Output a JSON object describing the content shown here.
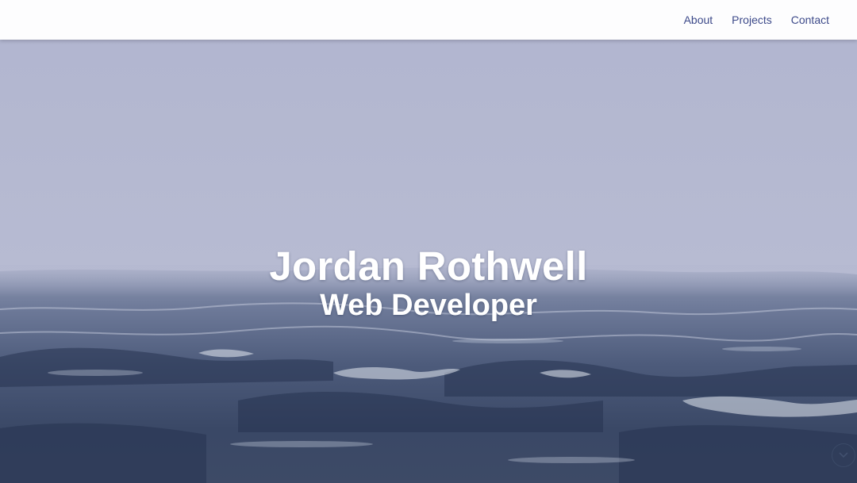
{
  "nav": {
    "links": [
      {
        "label": "About"
      },
      {
        "label": "Projects"
      },
      {
        "label": "Contact"
      }
    ]
  },
  "hero": {
    "name": "Jordan Rothwell",
    "title": "Web Developer",
    "background": "stormy-sea-photo",
    "scroll_icon": "chevron-down-icon"
  },
  "colors": {
    "nav_background": "#fdfdfe",
    "nav_link": "#3d4a8a",
    "sky": "#b4b8d0",
    "sea_dark": "#2c3a55",
    "hero_text": "#ffffff"
  }
}
